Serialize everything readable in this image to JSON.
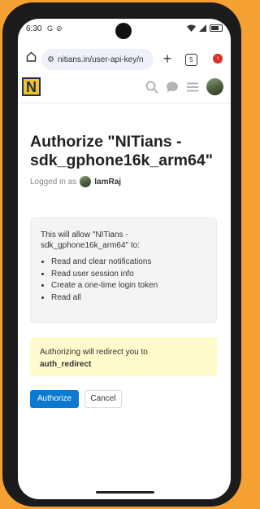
{
  "status_bar": {
    "time": "6:30",
    "left_icons": [
      "G",
      "⊘"
    ],
    "right_icons": [
      "wifi-icon",
      "signal-icon",
      "battery-icon"
    ]
  },
  "browser": {
    "url": "nitians.in/user-api-key/n",
    "tab_count": "5",
    "update_badge": "↑"
  },
  "site": {
    "logo_letter": "N",
    "header_icons": [
      "search-icon",
      "chat-icon",
      "menu-icon",
      "avatar"
    ]
  },
  "page": {
    "title": "Authorize \"NITians - sdk_gphone16k_arm64\"",
    "logged_in_label": "Logged in as",
    "username": "IamRaj",
    "allow_intro": "This will allow \"NITians - sdk_gphone16k_arm64\" to:",
    "permissions": [
      "Read and clear notifications",
      "Read user session info",
      "Create a one-time login token",
      "Read all"
    ],
    "redirect_notice": "Authorizing will redirect you to",
    "redirect_target": "auth_redirect",
    "authorize_label": "Authorize",
    "cancel_label": "Cancel"
  },
  "colors": {
    "background": "#f5a032",
    "primary_button": "#0b79d0",
    "notice_bg": "#fffbcc",
    "logo_bg": "#f4c51e"
  }
}
